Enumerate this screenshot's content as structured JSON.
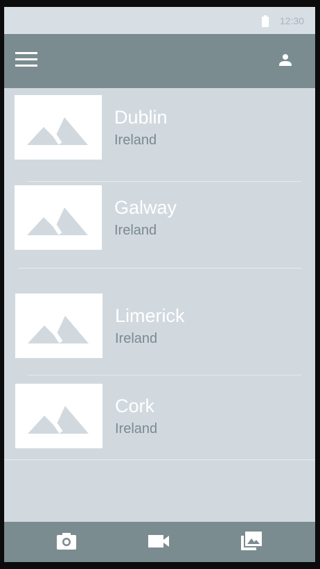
{
  "status_bar": {
    "time": "12:30",
    "battery_icon": "battery-icon"
  },
  "app_bar": {
    "menu_icon": "menu-icon",
    "account_icon": "account-icon"
  },
  "list": {
    "items": [
      {
        "title": "Dublin",
        "subtitle": "Ireland",
        "thumbnail_icon": "image-placeholder-icon"
      },
      {
        "title": "Galway",
        "subtitle": "Ireland",
        "thumbnail_icon": "image-placeholder-icon"
      },
      {
        "title": "Limerick",
        "subtitle": "Ireland",
        "thumbnail_icon": "image-placeholder-icon"
      },
      {
        "title": "Cork",
        "subtitle": "Ireland",
        "thumbnail_icon": "image-placeholder-icon"
      }
    ]
  },
  "bottom_bar": {
    "buttons": [
      {
        "icon": "camera-icon"
      },
      {
        "icon": "video-icon"
      },
      {
        "icon": "gallery-icon"
      }
    ]
  },
  "colors": {
    "background": "#d1d9df",
    "bars": "#7b8c90",
    "title_text": "#ffffff",
    "subtitle_text": "#7a8a90",
    "thumbnail_bg": "#ffffff",
    "placeholder_shape": "#d1d9df"
  }
}
